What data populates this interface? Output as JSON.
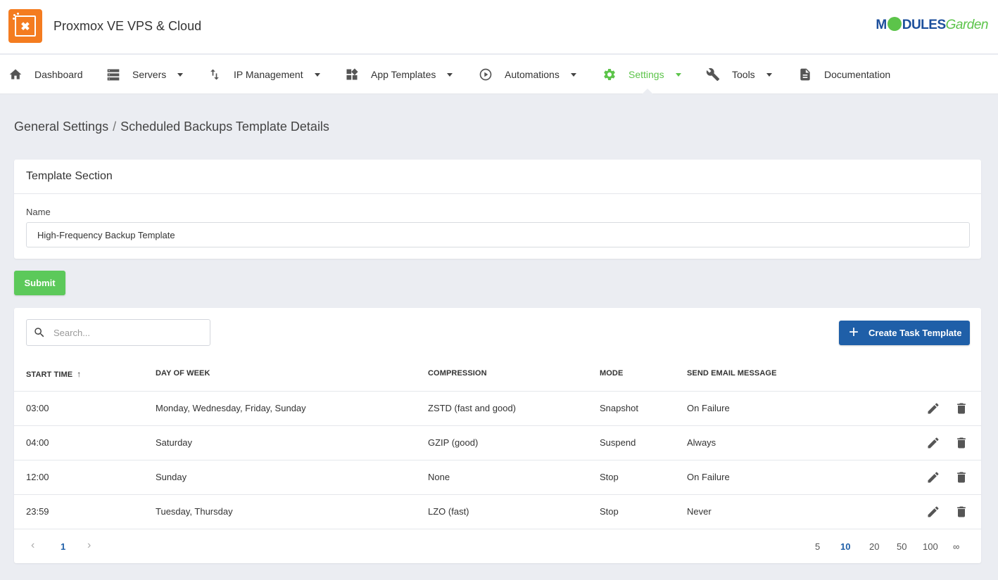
{
  "app": {
    "title": "Proxmox VE VPS & Cloud",
    "brand_part1": "M",
    "brand_part2": "DULES",
    "brand_part3": "Garden"
  },
  "nav": {
    "items": [
      {
        "label": "Dashboard",
        "icon": "home-icon"
      },
      {
        "label": "Servers",
        "icon": "servers-icon"
      },
      {
        "label": "IP Management",
        "icon": "arrows-up-down-icon"
      },
      {
        "label": "App Templates",
        "icon": "widgets-icon"
      },
      {
        "label": "Automations",
        "icon": "play-circle-icon"
      },
      {
        "label": "Settings",
        "icon": "gear-icon",
        "active": true
      },
      {
        "label": "Tools",
        "icon": "wrench-icon"
      },
      {
        "label": "Documentation",
        "icon": "document-icon"
      }
    ]
  },
  "breadcrumb": {
    "parent": "General Settings",
    "separator": "/",
    "current": "Scheduled Backups Template Details"
  },
  "template_section": {
    "title": "Template Section",
    "name_label": "Name",
    "name_value": "High-Frequency Backup Template"
  },
  "submit_label": "Submit",
  "table": {
    "search_placeholder": "Search...",
    "create_label": "Create Task Template",
    "sort_indicator": "↑",
    "columns": {
      "start_time": "START TIME",
      "day_of_week": "DAY OF WEEK",
      "compression": "COMPRESSION",
      "mode": "MODE",
      "send_email": "SEND EMAIL MESSAGE"
    },
    "rows": [
      {
        "start_time": "03:00",
        "day_of_week": "Monday, Wednesday, Friday, Sunday",
        "compression": "ZSTD (fast and good)",
        "mode": "Snapshot",
        "send_email": "On Failure"
      },
      {
        "start_time": "04:00",
        "day_of_week": "Saturday",
        "compression": "GZIP (good)",
        "mode": "Suspend",
        "send_email": "Always"
      },
      {
        "start_time": "12:00",
        "day_of_week": "Sunday",
        "compression": "None",
        "mode": "Stop",
        "send_email": "On Failure"
      },
      {
        "start_time": "23:59",
        "day_of_week": "Tuesday, Thursday",
        "compression": "LZO (fast)",
        "mode": "Stop",
        "send_email": "Never"
      }
    ]
  },
  "pagination": {
    "prev": "‹",
    "current_page": "1",
    "next": "›",
    "sizes": [
      "5",
      "10",
      "20",
      "50",
      "100",
      "∞"
    ],
    "active_size": "10"
  },
  "colors": {
    "accent_green": "#5cc44a",
    "primary_blue": "#1f5fa8",
    "logo_orange": "#f47c20"
  }
}
